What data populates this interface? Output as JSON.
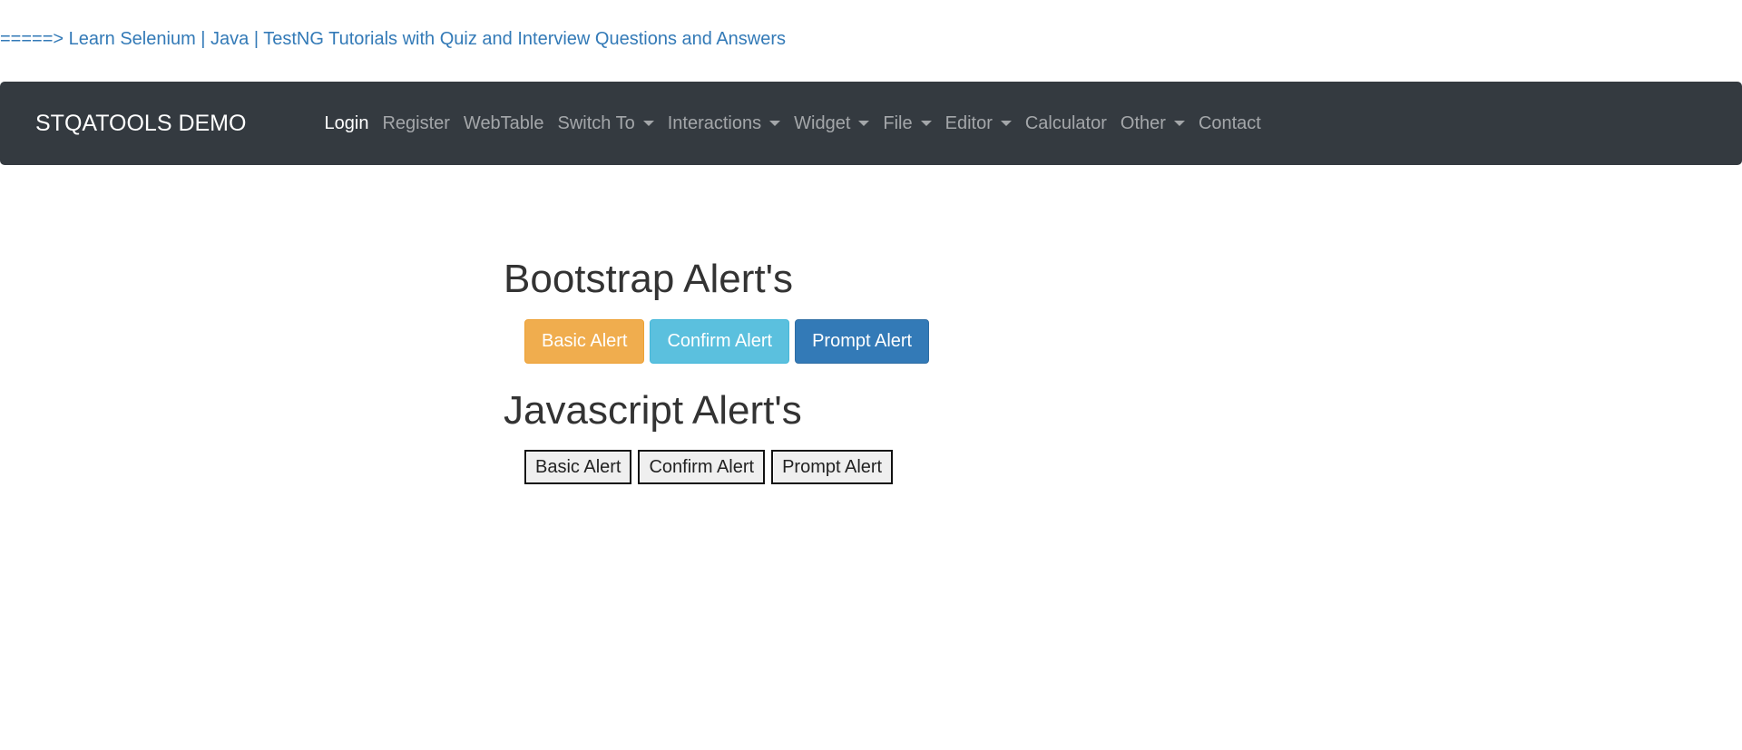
{
  "top_link": "=====> Learn Selenium | Java | TestNG Tutorials with Quiz and Interview Questions and Answers",
  "navbar": {
    "brand": "STQATOOLS DEMO",
    "items": [
      {
        "label": "Login",
        "dropdown": false,
        "active": true
      },
      {
        "label": "Register",
        "dropdown": false
      },
      {
        "label": "WebTable",
        "dropdown": false
      },
      {
        "label": "Switch To",
        "dropdown": true
      },
      {
        "label": "Interactions",
        "dropdown": true
      },
      {
        "label": "Widget",
        "dropdown": true
      },
      {
        "label": "File",
        "dropdown": true
      },
      {
        "label": "Editor",
        "dropdown": true
      },
      {
        "label": "Calculator",
        "dropdown": false
      },
      {
        "label": "Other",
        "dropdown": true
      },
      {
        "label": "Contact",
        "dropdown": false
      }
    ]
  },
  "bootstrap_section": {
    "title": "Bootstrap Alert's",
    "buttons": {
      "basic": "Basic Alert",
      "confirm": "Confirm Alert",
      "prompt": "Prompt Alert"
    }
  },
  "javascript_section": {
    "title": "Javascript Alert's",
    "buttons": {
      "basic": "Basic Alert",
      "confirm": "Confirm Alert",
      "prompt": "Prompt Alert"
    }
  },
  "colors": {
    "navbar_bg": "#343a40",
    "link": "#337ab7",
    "warning": "#f0ad4e",
    "info": "#5bc0de",
    "primary": "#337ab7"
  }
}
